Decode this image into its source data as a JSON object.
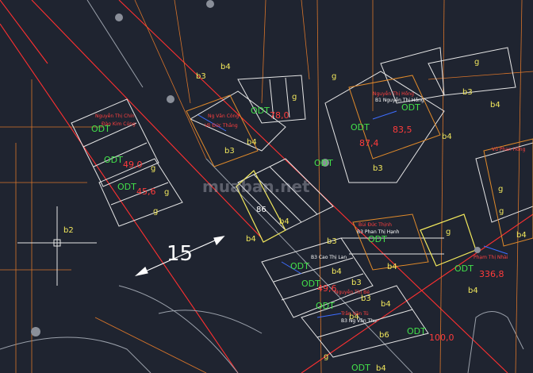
{
  "drawing": {
    "dimension_label": "15",
    "watermark": "muaban.net",
    "zone_labels": [
      "b3",
      "b4",
      "g",
      "b3",
      "b4",
      "b3",
      "b4",
      "g",
      "b3",
      "b4",
      "g",
      "g",
      "g",
      "b2",
      "b4",
      "b4",
      "b3",
      "b4",
      "b3",
      "b4",
      "b6",
      "g",
      "b3",
      "b4",
      "g",
      "g",
      "b4",
      "b4",
      "g",
      "b4",
      "g",
      "b4"
    ],
    "odt_labels": [
      "ODT",
      "ODT",
      "ODT",
      "ODT",
      "ODT",
      "ODT",
      "ODT",
      "ODT",
      "ODT",
      "ODT",
      "ODT",
      "ODT",
      "ODT",
      "ODT"
    ],
    "area_values": [
      "49,0",
      "45,6",
      "78,0",
      "87,4",
      "83,5",
      "49,6",
      "336,8",
      "100,0",
      "86"
    ],
    "owner_names": [
      "Nguyễn Thị Chín",
      "Đào Kim Cúng",
      "Nguyễn Thị Hồng",
      "Ng Văn Công",
      "Võ Đức Thắng",
      "Vũ Phan Hồng",
      "Bùi Đức Thịnh",
      "Nguyễn Thị Bé",
      "Phạm Thị Nhài",
      "Trần Văn Tú"
    ],
    "parcel_codes": [
      "B1 Nguyễn Thị Hồng",
      "B3 Phan Thị Hạnh",
      "B3 Cao Thị Lan",
      "B3 Ng Văn Thu"
    ]
  }
}
